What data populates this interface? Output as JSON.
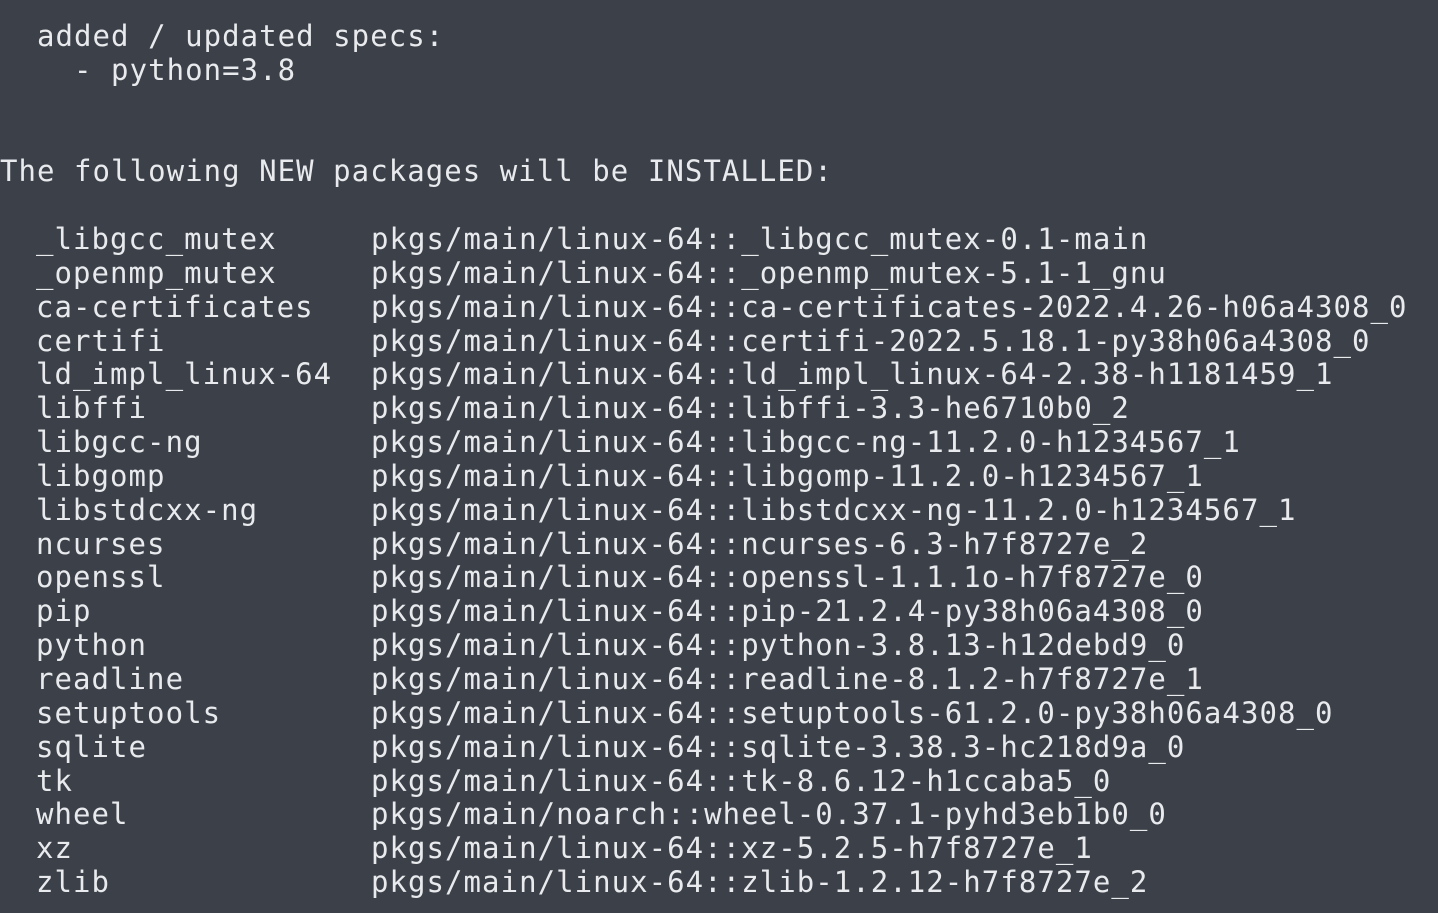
{
  "spec_header": "  added / updated specs:",
  "spec_item": "    - python=3.8",
  "install_header": "The following NEW packages will be INSTALLED:",
  "packages": [
    {
      "name": "_libgcc_mutex",
      "spec": "pkgs/main/linux-64::_libgcc_mutex-0.1-main"
    },
    {
      "name": "_openmp_mutex",
      "spec": "pkgs/main/linux-64::_openmp_mutex-5.1-1_gnu"
    },
    {
      "name": "ca-certificates",
      "spec": "pkgs/main/linux-64::ca-certificates-2022.4.26-h06a4308_0"
    },
    {
      "name": "certifi",
      "spec": "pkgs/main/linux-64::certifi-2022.5.18.1-py38h06a4308_0"
    },
    {
      "name": "ld_impl_linux-64",
      "spec": "pkgs/main/linux-64::ld_impl_linux-64-2.38-h1181459_1"
    },
    {
      "name": "libffi",
      "spec": "pkgs/main/linux-64::libffi-3.3-he6710b0_2"
    },
    {
      "name": "libgcc-ng",
      "spec": "pkgs/main/linux-64::libgcc-ng-11.2.0-h1234567_1"
    },
    {
      "name": "libgomp",
      "spec": "pkgs/main/linux-64::libgomp-11.2.0-h1234567_1"
    },
    {
      "name": "libstdcxx-ng",
      "spec": "pkgs/main/linux-64::libstdcxx-ng-11.2.0-h1234567_1"
    },
    {
      "name": "ncurses",
      "spec": "pkgs/main/linux-64::ncurses-6.3-h7f8727e_2"
    },
    {
      "name": "openssl",
      "spec": "pkgs/main/linux-64::openssl-1.1.1o-h7f8727e_0"
    },
    {
      "name": "pip",
      "spec": "pkgs/main/linux-64::pip-21.2.4-py38h06a4308_0"
    },
    {
      "name": "python",
      "spec": "pkgs/main/linux-64::python-3.8.13-h12debd9_0"
    },
    {
      "name": "readline",
      "spec": "pkgs/main/linux-64::readline-8.1.2-h7f8727e_1"
    },
    {
      "name": "setuptools",
      "spec": "pkgs/main/linux-64::setuptools-61.2.0-py38h06a4308_0"
    },
    {
      "name": "sqlite",
      "spec": "pkgs/main/linux-64::sqlite-3.38.3-hc218d9a_0"
    },
    {
      "name": "tk",
      "spec": "pkgs/main/linux-64::tk-8.6.12-h1ccaba5_0"
    },
    {
      "name": "wheel",
      "spec": "pkgs/main/noarch::wheel-0.37.1-pyhd3eb1b0_0"
    },
    {
      "name": "xz",
      "spec": "pkgs/main/linux-64::xz-5.2.5-h7f8727e_1"
    },
    {
      "name": "zlib",
      "spec": "pkgs/main/linux-64::zlib-1.2.12-h7f8727e_2"
    }
  ]
}
